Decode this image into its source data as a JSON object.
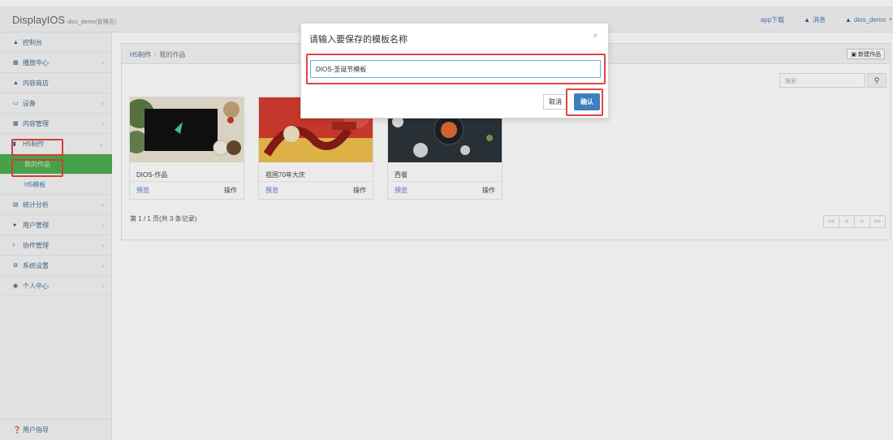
{
  "header": {
    "brand": "DisplayIOS",
    "user_role": "dios_demo(管理员)",
    "links": [
      {
        "icon": "download-icon",
        "label": "app下载"
      },
      {
        "icon": "bell-icon",
        "label": "消息"
      },
      {
        "icon": "user-icon",
        "label": "dios_demo"
      }
    ]
  },
  "sidebar": {
    "items": [
      {
        "icon": "dashboard-icon",
        "label": "控制台"
      },
      {
        "icon": "grid-icon",
        "label": "播放中心",
        "chevron": "‹"
      },
      {
        "icon": "shop-icon",
        "label": "内容商店"
      },
      {
        "icon": "monitor-icon",
        "label": "设备",
        "chevron": "‹"
      },
      {
        "icon": "copy-icon",
        "label": "内容管理",
        "chevron": "‹"
      },
      {
        "icon": "h5-icon",
        "label": "H5制作",
        "chevron": "⌄"
      },
      {
        "label": "我的作品"
      },
      {
        "label": "H5模板"
      },
      {
        "icon": "chart-icon",
        "label": "统计分析",
        "chevron": "‹"
      },
      {
        "icon": "users-icon",
        "label": "用户管理",
        "chevron": "‹"
      },
      {
        "icon": "sitemap-icon",
        "label": "协作管理",
        "chevron": "‹"
      },
      {
        "icon": "gear-icon",
        "label": "系统设置",
        "chevron": "‹"
      },
      {
        "icon": "person-icon",
        "label": "个人中心",
        "chevron": "‹"
      }
    ],
    "footer": "用户指导"
  },
  "main": {
    "breadcrumb": [
      "H5制作",
      "我的作品"
    ],
    "new_button": "新建作品",
    "search_placeholder": "搜索",
    "cards": [
      {
        "title": "DIOS-作品",
        "preview": "预览",
        "operate": "操作"
      },
      {
        "title": "祖国70年大庆",
        "preview": "预览",
        "operate": "操作"
      },
      {
        "title": "西餐",
        "preview": "预览",
        "operate": "操作"
      }
    ],
    "page_info": "第 1 / 1 页(共 3 条记录)",
    "pager": [
      "<<",
      "<",
      ">",
      ">>"
    ]
  },
  "modal": {
    "title": "请输入要保存的模板名称",
    "input_value": "DIOS-圣诞节模板",
    "cancel": "取消",
    "confirm": "确认"
  },
  "colors": {
    "accent": "#3c7fc0",
    "active_menu": "#4caf50",
    "highlight": "#e0463e"
  }
}
